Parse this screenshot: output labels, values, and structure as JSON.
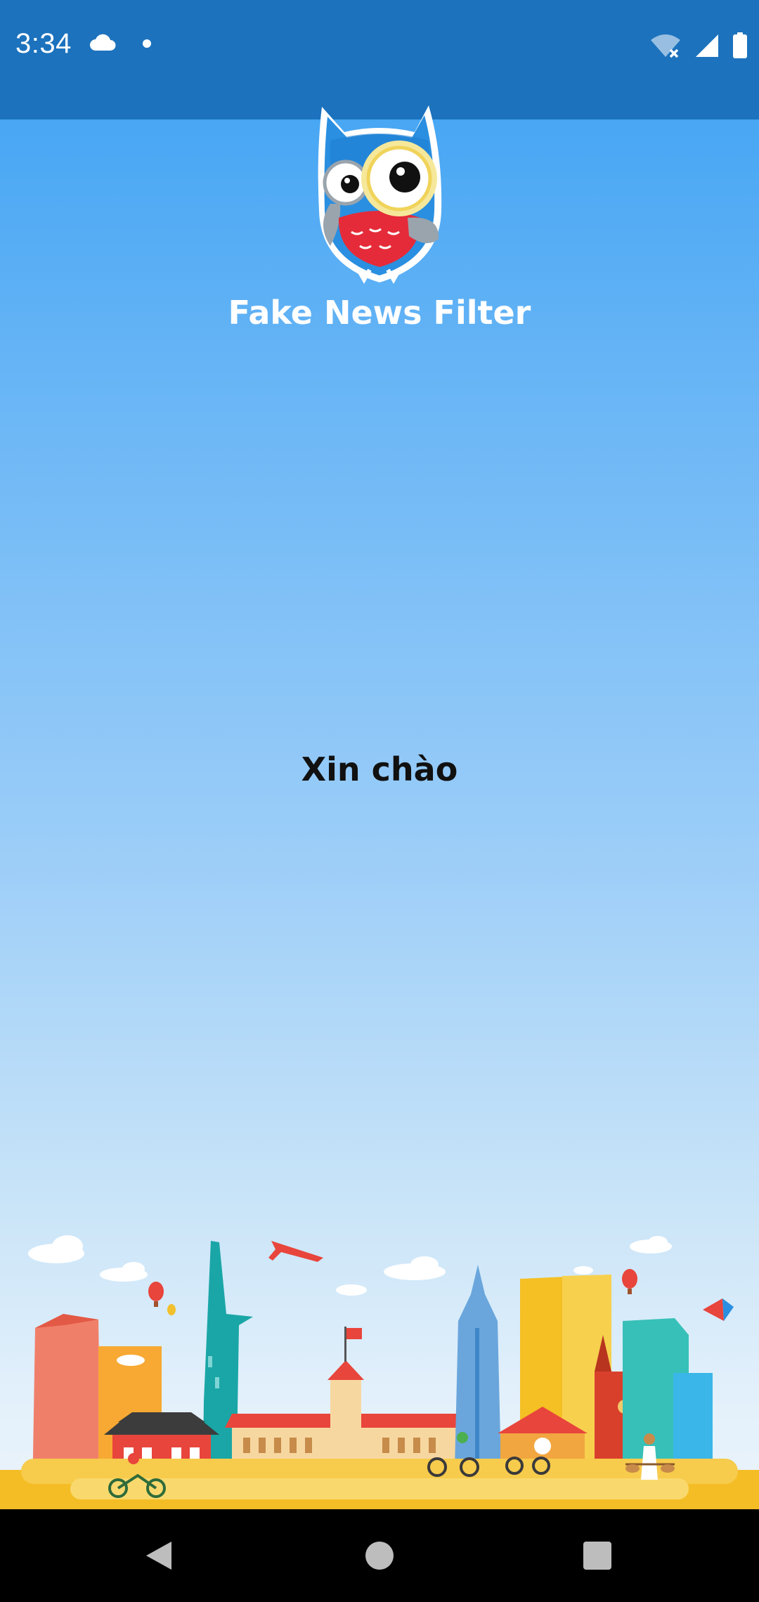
{
  "status_bar": {
    "time": "3:34",
    "icons_left": [
      "cloud-icon",
      "dot-icon"
    ],
    "icons_right": [
      "wifi-off-icon",
      "signal-icon",
      "battery-icon"
    ]
  },
  "header": {
    "logo": "owl-magnifier-logo",
    "title": "Fake News Filter"
  },
  "main": {
    "greeting": "Xin chào"
  },
  "illustration": {
    "name": "city-skyline-illustration"
  },
  "nav_bar": {
    "buttons": [
      "back-icon",
      "home-icon",
      "recents-icon"
    ]
  },
  "colors": {
    "status_bar": "#1c72bd",
    "background_top": "#3aa0f2",
    "background_bottom": "#f0f6fc",
    "title_text": "#ffffff",
    "greeting_text": "#111111",
    "nav_bar": "#000000"
  }
}
